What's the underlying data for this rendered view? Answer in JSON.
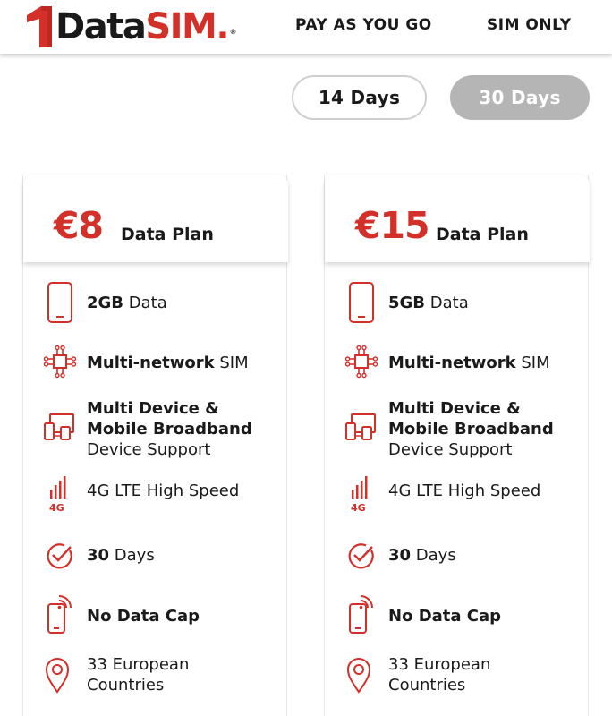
{
  "brand": {
    "logo_one": "1",
    "logo_data": "Data",
    "logo_sim": "SIM",
    "logo_dot": ".",
    "logo_reg": "®",
    "accent_color": "#d3302a"
  },
  "nav": {
    "pay_as_you_go": "PAY AS YOU GO",
    "sim_only": "SIM ONLY"
  },
  "duration_toggle": {
    "option_14": "14 Days",
    "option_30": "30 Days",
    "selected": "30 Days"
  },
  "plans": [
    {
      "price": "€8",
      "label": "Data Plan",
      "features": {
        "data_bold": "2GB",
        "data_rest": " Data",
        "network_bold": "Multi-network",
        "network_rest": " SIM",
        "device_line1": "Multi Device &",
        "device_line2": "Mobile Broadband",
        "device_line3": "Device Support",
        "speed": "4G LTE High Speed",
        "speed_icon_label": "4G",
        "days_bold": "30",
        "days_rest": " Days",
        "cap": "No Data Cap",
        "countries_line1": "33 European",
        "countries_line2": "Countries"
      }
    },
    {
      "price": "€15",
      "label": "Data Plan",
      "features": {
        "data_bold": "5GB",
        "data_rest": " Data",
        "network_bold": "Multi-network",
        "network_rest": " SIM",
        "device_line1": "Multi Device &",
        "device_line2": "Mobile Broadband",
        "device_line3": "Device Support",
        "speed": "4G LTE High Speed",
        "speed_icon_label": "4G",
        "days_bold": "30",
        "days_rest": " Days",
        "cap": "No Data Cap",
        "countries_line1": "33 European",
        "countries_line2": "Countries"
      }
    }
  ],
  "icons": [
    "phone-icon",
    "network-chip-icon",
    "multi-device-icon",
    "signal-4g-icon",
    "check-circle-icon",
    "phone-wifi-icon",
    "location-pin-icon"
  ]
}
